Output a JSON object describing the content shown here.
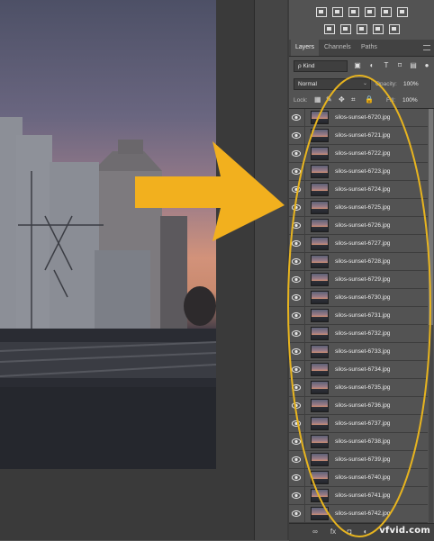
{
  "colors": {
    "panel_bg": "#535353",
    "annotation_yellow": "#f2b01e",
    "sunset": "#d79373"
  },
  "adjustments": {
    "icons_row1": [
      "brightness-contrast-icon",
      "levels-icon",
      "curves-icon",
      "exposure-icon",
      "vibrance-icon",
      "color-lookup-icon"
    ],
    "icons_row2": [
      "invert-icon",
      "posterize-icon",
      "threshold-icon",
      "gradient-map-icon",
      "selective-color-icon"
    ]
  },
  "tabs": [
    {
      "label": "Layers",
      "active": true
    },
    {
      "label": "Channels",
      "active": false
    },
    {
      "label": "Paths",
      "active": false
    }
  ],
  "filter": {
    "kind_label": "ρ Kind"
  },
  "blend": {
    "mode": "Normal",
    "opacity_label": "Opacity:",
    "opacity_value": "100%",
    "lock_label": "Lock:",
    "fill_label": "Fill:",
    "fill_value": "100%"
  },
  "layers": [
    "silos-sunset-6720.jpg",
    "silos-sunset-6721.jpg",
    "silos-sunset-6722.jpg",
    "silos-sunset-6723.jpg",
    "silos-sunset-6724.jpg",
    "silos-sunset-6725.jpg",
    "silos-sunset-6726.jpg",
    "silos-sunset-6727.jpg",
    "silos-sunset-6728.jpg",
    "silos-sunset-6729.jpg",
    "silos-sunset-6730.jpg",
    "silos-sunset-6731.jpg",
    "silos-sunset-6732.jpg",
    "silos-sunset-6733.jpg",
    "silos-sunset-6734.jpg",
    "silos-sunset-6735.jpg",
    "silos-sunset-6736.jpg",
    "silos-sunset-6737.jpg",
    "silos-sunset-6738.jpg",
    "silos-sunset-6739.jpg",
    "silos-sunset-6740.jpg",
    "silos-sunset-6741.jpg",
    "silos-sunset-6742.jpg"
  ],
  "footer": {
    "watermark": "vfvid.com"
  }
}
